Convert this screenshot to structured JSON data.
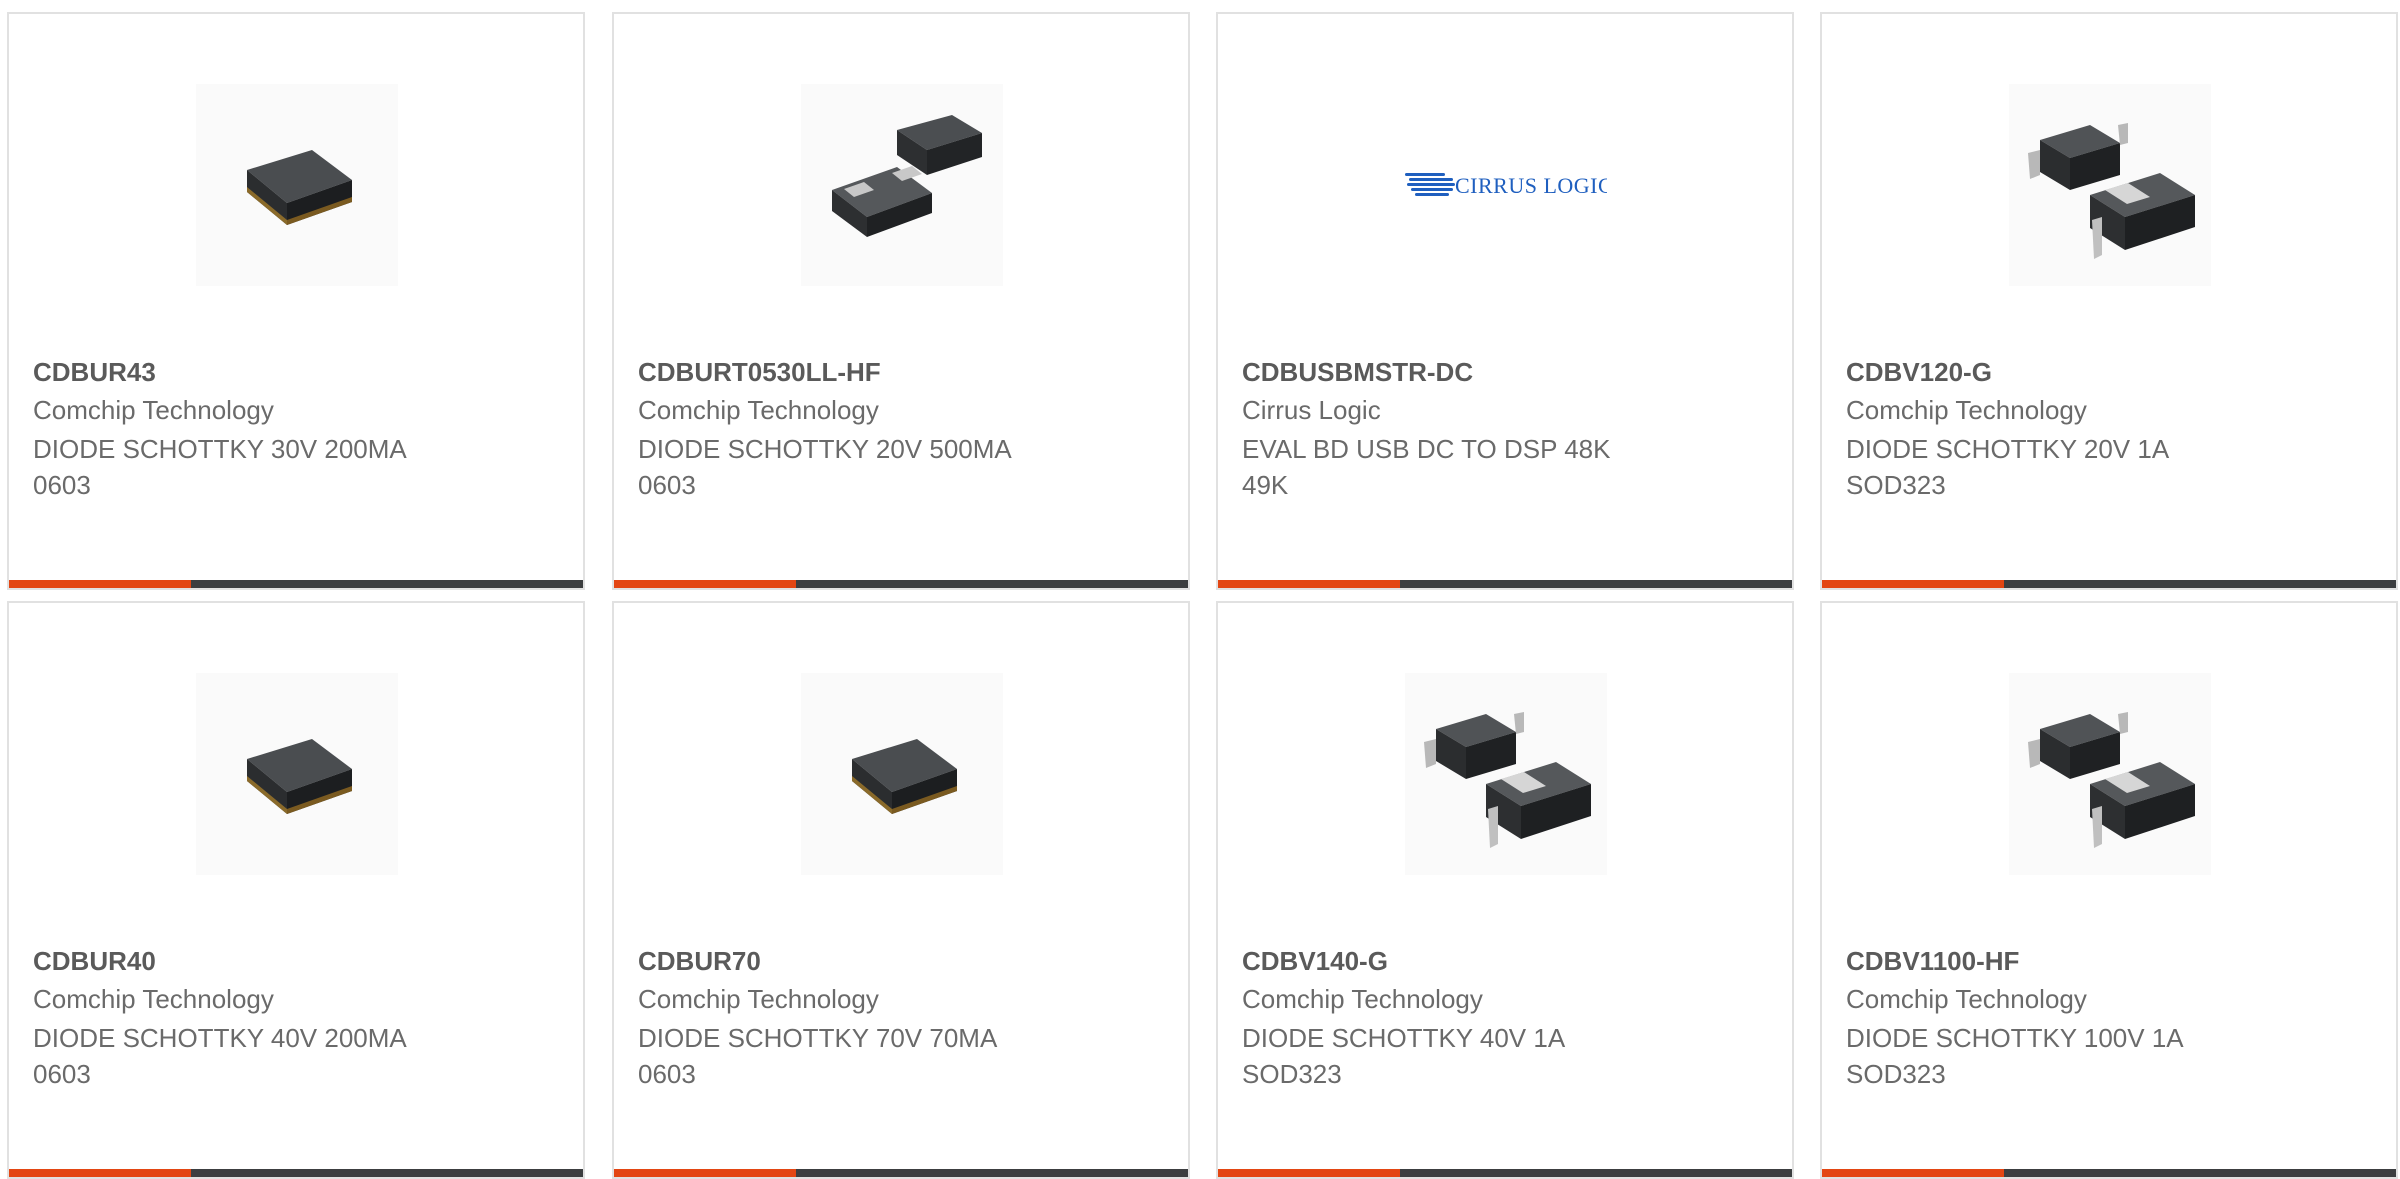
{
  "products": [
    {
      "part": "CDBUR43",
      "manufacturer": "Comchip Technology",
      "description": "DIODE SCHOTTKY 30V 200MA\n0603",
      "image_icon": "chip-0603-icon"
    },
    {
      "part": "CDBURT0530LL-HF",
      "manufacturer": "Comchip Technology",
      "description": "DIODE SCHOTTKY 20V 500MA\n0603",
      "image_icon": "chip-pair-icon"
    },
    {
      "part": "CDBUSBMSTR-DC",
      "manufacturer": "Cirrus Logic",
      "description": "EVAL BD USB DC TO DSP 48K\n49K",
      "image_icon": "cirrus-logic-logo",
      "logo_text": "CIRRUS LOGIC"
    },
    {
      "part": "CDBV120-G",
      "manufacturer": "Comchip Technology",
      "description": "DIODE SCHOTTKY 20V 1A\nSOD323",
      "image_icon": "sod323-pair-icon"
    },
    {
      "part": "CDBUR40",
      "manufacturer": "Comchip Technology",
      "description": "DIODE SCHOTTKY 40V 200MA\n0603",
      "image_icon": "chip-0603-icon"
    },
    {
      "part": "CDBUR70",
      "manufacturer": "Comchip Technology",
      "description": "DIODE SCHOTTKY 70V 70MA\n0603",
      "image_icon": "chip-0603-icon"
    },
    {
      "part": "CDBV140-G",
      "manufacturer": "Comchip Technology",
      "description": "DIODE SCHOTTKY 40V 1A\nSOD323",
      "image_icon": "sod323-pair-icon"
    },
    {
      "part": "CDBV1100-HF",
      "manufacturer": "Comchip Technology",
      "description": "DIODE SCHOTTKY 100V 1A\nSOD323",
      "image_icon": "sod323-pair-icon"
    }
  ],
  "colors": {
    "accent": "#e34613",
    "bar": "#3c3e40",
    "border": "#e1e1e1",
    "title": "#5a5a5a",
    "text": "#6a6a6a"
  }
}
